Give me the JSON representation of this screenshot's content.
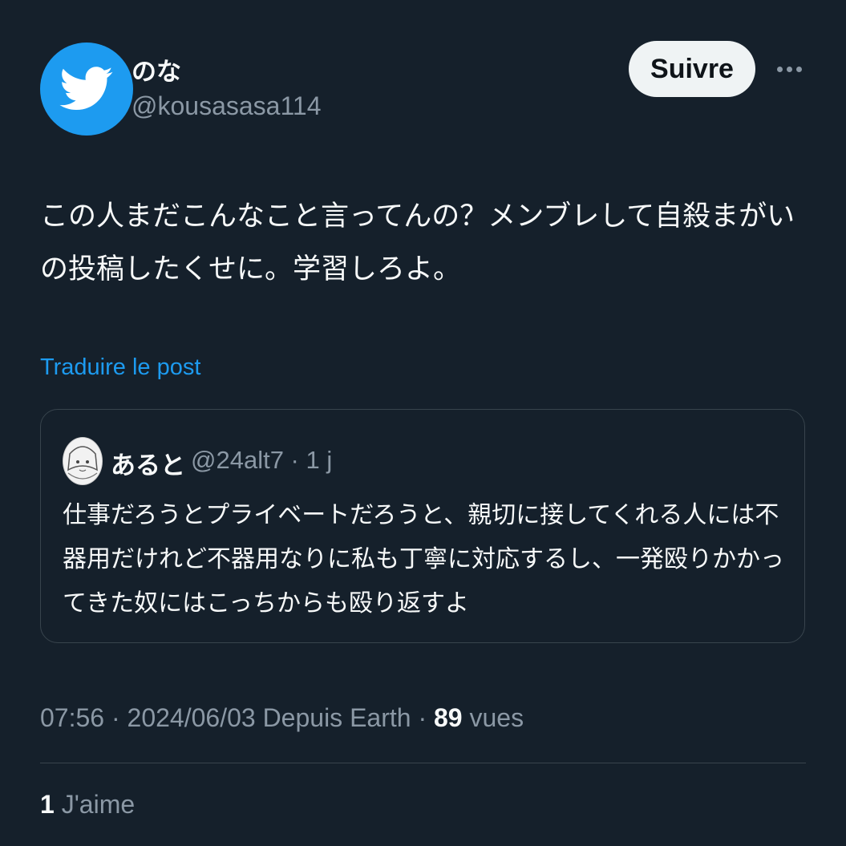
{
  "author": {
    "display_name": "のな",
    "handle": "@kousasasa114",
    "avatar_icon": "twitter-bird-icon",
    "avatar_color": "#1d9bf0"
  },
  "actions": {
    "follow_label": "Suivre",
    "more_icon": "more-horizontal-icon"
  },
  "post": {
    "text": "この人まだこんなこと言ってんの？メンブレして自殺まがい\nの投稿したくせに。学習しろよ。",
    "translate_label": "Traduire le post"
  },
  "quote": {
    "display_name": "あると",
    "handle_meta": "@24alt7 · 1 j",
    "text": "仕事だろうとプライベートだろうと、親切に接してくれる人には不\n器用だけれど不器用なりに私も丁寧に対応するし、一発殴りかかっ\nてきた奴にはこっちからも殴り返すよ"
  },
  "meta": {
    "timestamp": "07:56 · 2024/06/03",
    "source": "Depuis Earth",
    "separator": "·",
    "views_count": "89",
    "views_label": "vues"
  },
  "engagement": {
    "likes_count": "1",
    "likes_label": "J'aime"
  },
  "colors": {
    "background": "#15202b",
    "accent": "#1d9bf0",
    "secondary_text": "#8b98a5",
    "border": "#38444d"
  }
}
